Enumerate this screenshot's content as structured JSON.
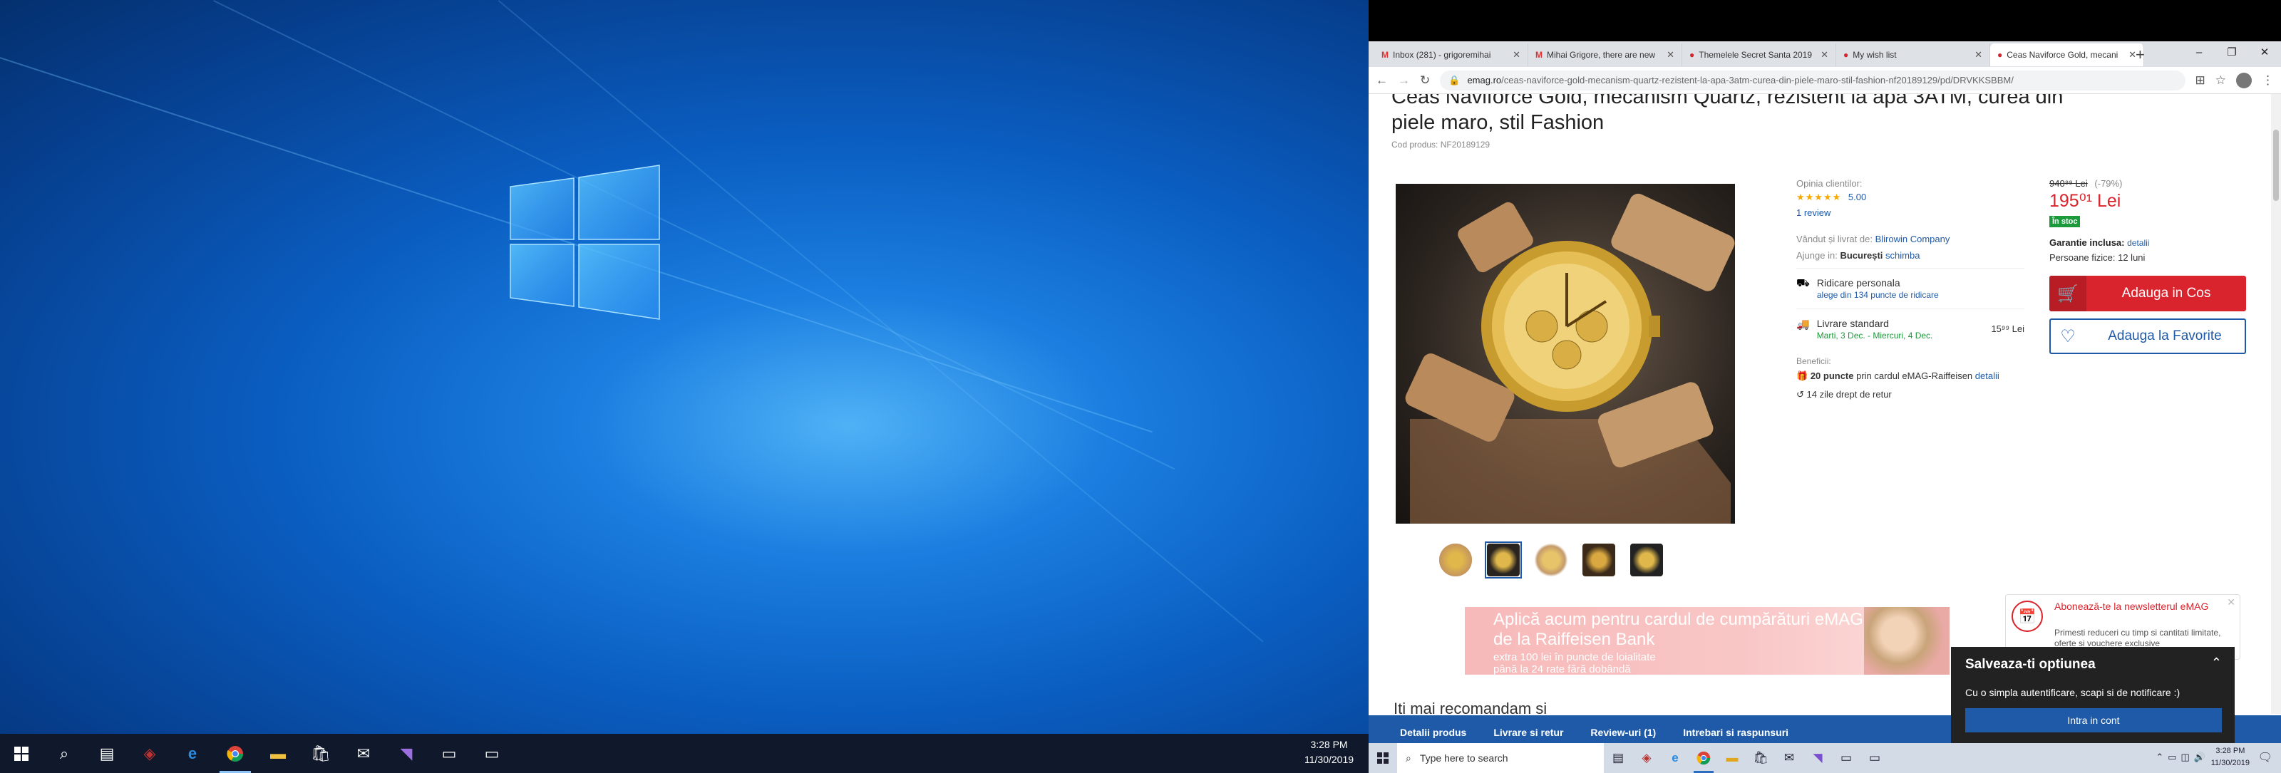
{
  "left_taskbar": {
    "clock_time": "3:28 PM",
    "clock_date": "11/30/2019",
    "icons": [
      "windows-start-icon",
      "search-icon",
      "task-view-icon",
      "predator-icon",
      "edge-icon",
      "chrome-icon",
      "file-explorer-icon",
      "store-icon",
      "mail-icon",
      "visual-studio-icon",
      "terminal-icon",
      "window-icon"
    ]
  },
  "browser": {
    "tabs": [
      {
        "title": "Inbox (281) - grigoremihai",
        "icon": "gmail-icon"
      },
      {
        "title": "Mihai Grigore, there are new",
        "icon": "gmail-icon"
      },
      {
        "title": "Themelele Secret Santa 2019",
        "icon": "emag-icon"
      },
      {
        "title": "My wish list",
        "icon": "emag-icon"
      },
      {
        "title": "Ceas Naviforce Gold, mecani",
        "icon": "emag-icon"
      }
    ],
    "url_domain": "emag.ro",
    "url_path": "/ceas-naviforce-gold-mecanism-quartz-rezistent-la-apa-3atm-curea-din-piele-maro-stil-fashion-nf20189129/pd/DRVKKSBBM/"
  },
  "product": {
    "title": "Ceas Naviforce Gold, mecanism Quartz, rezistent la apa 3ATM, curea din piele maro, stil Fashion",
    "code": "Cod produs: NF20189129",
    "rating_label": "Opinia clientilor:",
    "rating_value": "5.00",
    "stars": 5,
    "reviews": "1 review",
    "seller_label": "Vândut și livrat de:",
    "seller": "Blirowin Company",
    "arrives_label": "Ajunge in:",
    "city": "București",
    "change": "schimba",
    "pickup_title": "Ridicare personala",
    "pickup_link": "alege din 134 puncte de ridicare",
    "delivery_title": "Livrare standard",
    "delivery_dates": "Marti, 3 Dec. - Miercuri, 4 Dec.",
    "delivery_price": "15⁹⁹ Lei",
    "benefits_label": "Beneficii:",
    "benefit1_bold": "20 puncte",
    "benefit1_rest": " prin cardul eMAG-Raiffeisen",
    "benefit1_link": "detalii",
    "benefit2": "14 zile drept de retur",
    "old_price": "940⁹⁹ Lei",
    "discount": "(-79%)",
    "price": "195⁰¹ Lei",
    "stock": "În stoc",
    "warranty_label": "Garantie inclusa:",
    "warranty_link": "detalii",
    "warranty_value": "Persoane fizice: 12 luni",
    "cart_button": "Adauga in Cos",
    "fav_button": "Adauga la Favorite"
  },
  "banner": {
    "title": "Aplică acum pentru cardul de cumpărături eMAG de la Raiffeisen Bank",
    "line1": "extra 100 lei în puncte de loialitate",
    "line2": "până la 24 rate fără dobândă"
  },
  "newsletter": {
    "title": "Abonează-te la newsletterul eMAG",
    "text": "Primesti reduceri cu timp si cantitati limitate, oferte si vouchere exclusive"
  },
  "more_rec": "Iti mai recomandam si",
  "bottom_bar": [
    "Detalii produs",
    "Livrare si retur",
    "Review-uri (1)",
    "Intrebari si raspunsuri"
  ],
  "popup": {
    "title": "Salveaza-ti optiunea",
    "text": "Cu o simpla autentificare, scapi si de notificare :)",
    "button": "Intra in cont"
  },
  "right_taskbar": {
    "search_placeholder": "Type here to search",
    "clock_time": "3:28 PM",
    "clock_date": "11/30/2019"
  },
  "colors": {
    "emag_red": "#d9232d",
    "emag_blue": "#1e5aa8",
    "stock_green": "#1a9a3a"
  }
}
